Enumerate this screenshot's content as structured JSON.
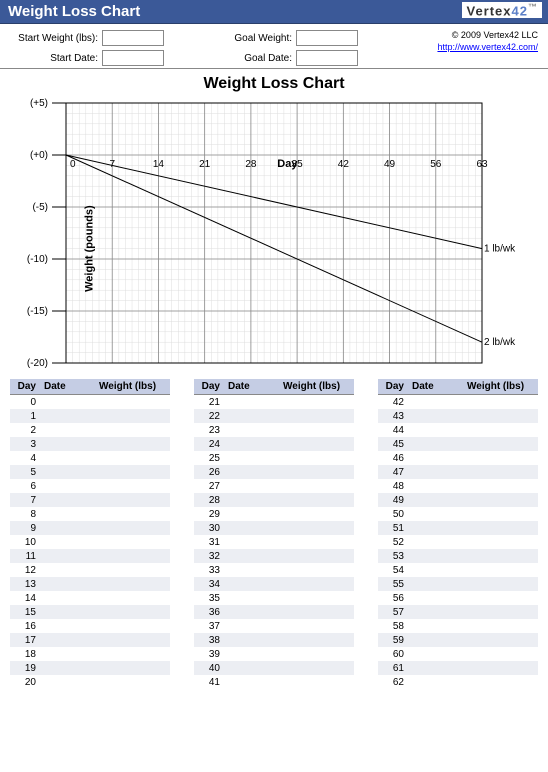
{
  "titlebar": "Weight Loss Chart",
  "logo": {
    "text": "Vertex",
    "num": "42",
    "tm": "™"
  },
  "inputs": {
    "start_weight_label": "Start Weight (lbs):",
    "start_date_label": "Start Date:",
    "goal_weight_label": "Goal Weight:",
    "goal_date_label": "Goal Date:",
    "start_weight": "",
    "start_date": "",
    "goal_weight": "",
    "goal_date": ""
  },
  "meta": {
    "copyright": "© 2009 Vertex42 LLC",
    "link": "http://www.vertex42.com/"
  },
  "chart_data": {
    "type": "line",
    "title": "Weight Loss Chart",
    "xlabel": "Day",
    "ylabel": "Weight (pounds)",
    "xlim": [
      0,
      63
    ],
    "ylim": [
      -20,
      5
    ],
    "xticks": [
      0,
      7,
      14,
      21,
      28,
      35,
      42,
      49,
      56,
      63
    ],
    "yticks_labels": [
      "(+5)",
      "(+0)",
      "(-5)",
      "(-10)",
      "(-15)",
      "(-20)"
    ],
    "yticks_values": [
      5,
      0,
      -5,
      -10,
      -15,
      -20
    ],
    "series": [
      {
        "name": "1 lb/wk",
        "x": [
          0,
          63
        ],
        "y": [
          0,
          -9
        ]
      },
      {
        "name": "2 lb/wk",
        "x": [
          0,
          63
        ],
        "y": [
          0,
          -18
        ]
      }
    ]
  },
  "tables": {
    "headers": {
      "day": "Day",
      "date": "Date",
      "weight": "Weight (lbs)"
    },
    "columns": [
      {
        "start": 0,
        "end": 20
      },
      {
        "start": 21,
        "end": 41
      },
      {
        "start": 42,
        "end": 62
      }
    ]
  }
}
